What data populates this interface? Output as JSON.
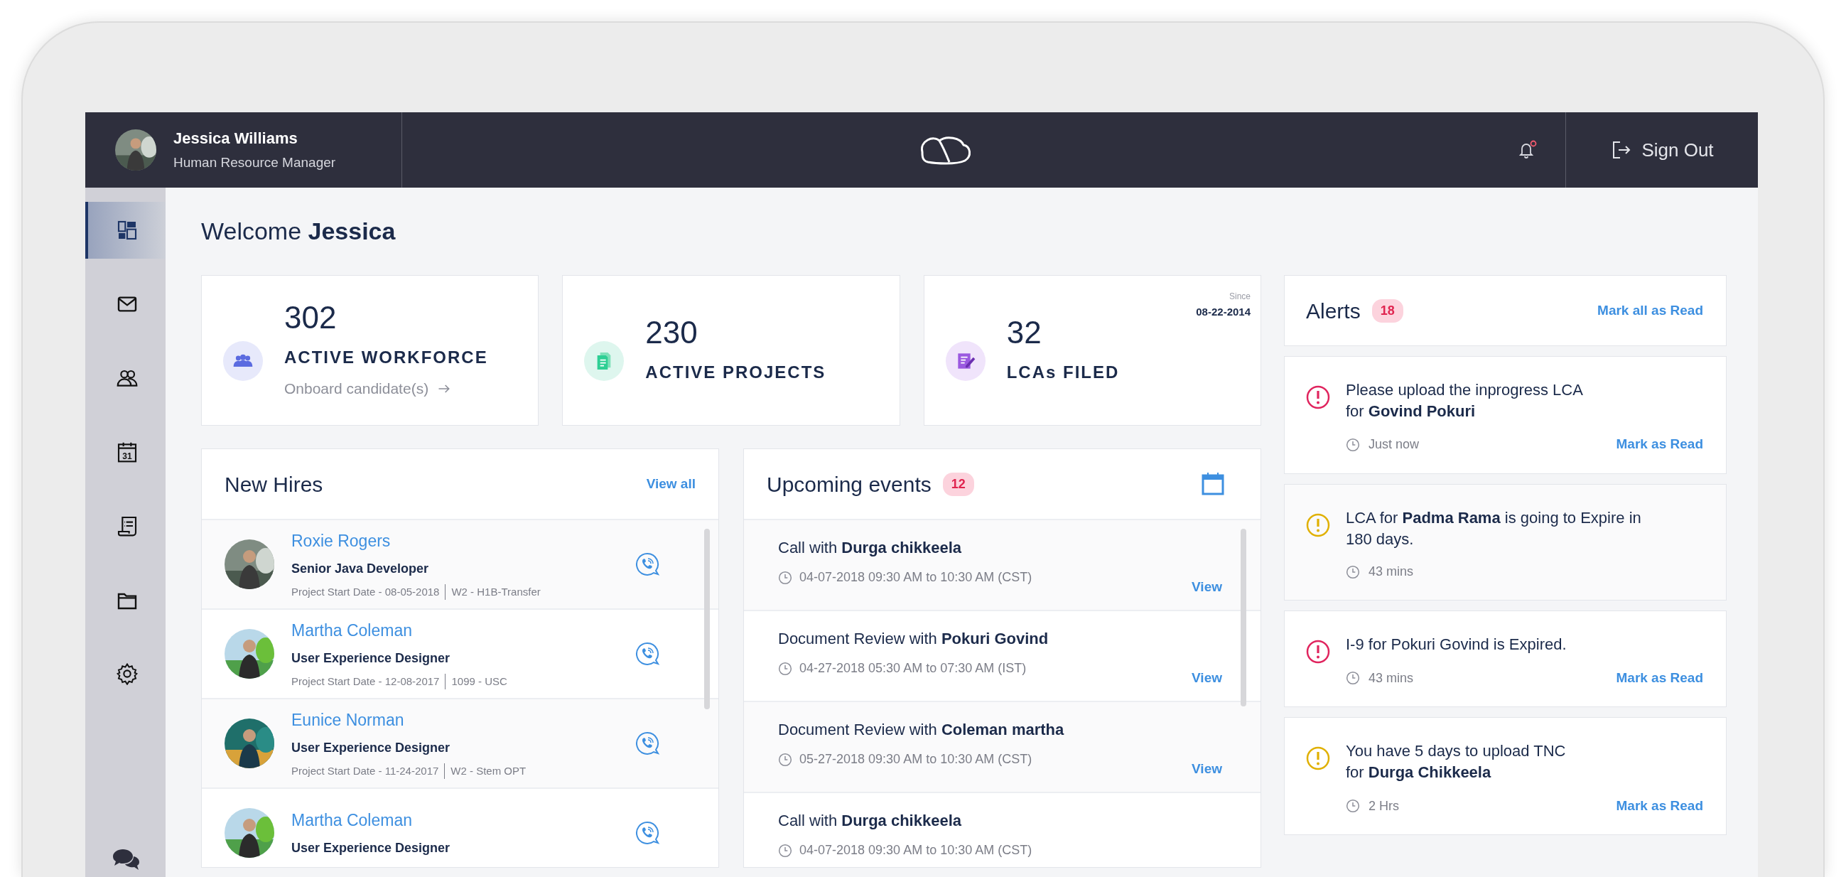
{
  "header": {
    "user_name": "Jessica Williams",
    "user_role": "Human Resource Manager",
    "notification_unread": true,
    "sign_out": "Sign Out"
  },
  "sidebar": {
    "items": [
      {
        "selected": true
      },
      {
        "selected": false
      },
      {
        "selected": false
      },
      {
        "icon_text": "31",
        "selected": false
      },
      {
        "selected": false
      },
      {
        "selected": false
      },
      {
        "selected": false
      }
    ]
  },
  "welcome": {
    "greeting": "Welcome",
    "name": "Jessica"
  },
  "stats": [
    {
      "kind": "workforce",
      "value": "302",
      "label": "ACTIVE WORKFORCE",
      "link": "Onboard candidate(s)"
    },
    {
      "kind": "projects",
      "value": "230",
      "label": "ACTIVE PROJECTS"
    },
    {
      "kind": "lcas",
      "value": "32",
      "label": "LCAs FILED",
      "since_label": "Since",
      "since_date": "08-22-2014"
    }
  ],
  "new_hires": {
    "title": "New Hires",
    "view_all": "View all",
    "items": [
      {
        "name": "Roxie Rogers",
        "role": "Senior Java Developer",
        "start_date": "Project Start Date - 08-05-2018",
        "visa": "W2 - H1B-Transfer"
      },
      {
        "name": "Martha Coleman",
        "role": "User Experience Designer",
        "start_date": "Project Start Date - 12-08-2017",
        "visa": "1099 - USC"
      },
      {
        "name": "Eunice Norman",
        "role": "User Experience Designer",
        "start_date": "Project Start Date - 11-24-2017",
        "visa": "W2 - Stem OPT"
      },
      {
        "name": "Martha Coleman",
        "role": "User Experience Designer"
      }
    ]
  },
  "events": {
    "title": "Upcoming events",
    "count": "12",
    "items": [
      {
        "title": "Call with **Durga chikkeela**",
        "time": "04-07-2018 09:30 AM to 10:30 AM (CST)",
        "view": "View"
      },
      {
        "title": "Document Review with **Pokuri Govind**",
        "time": "04-27-2018 05:30 AM to 07:30 AM (IST)",
        "view": "View"
      },
      {
        "title": "Document Review with **Coleman martha**",
        "time": "05-27-2018 09:30 AM to 10:30 AM (CST)",
        "view": "View"
      },
      {
        "title": "Call with **Durga chikkeela**",
        "time": "04-07-2018 09:30 AM to 10:30 AM (CST)"
      }
    ]
  },
  "alerts": {
    "title": "Alerts",
    "count": "18",
    "mark_all": "Mark all as Read",
    "items": [
      {
        "color": "#e0245e",
        "read": false,
        "text": "Please upload the inprogress LCA\nfor  **Govind Pokuri**",
        "time": "Just now",
        "action": "Mark as Read"
      },
      {
        "color": "#e0b000",
        "read": true,
        "text": "LCA for **Padma Rama** is going to Expire in\n180 days.",
        "time": "43 mins"
      },
      {
        "color": "#e0245e",
        "read": false,
        "text": "I-9 for Pokuri Govind is Expired.",
        "time": "43 mins",
        "action": "Mark as Read"
      },
      {
        "color": "#e0b000",
        "read": false,
        "text": "You have 5 days to upload TNC\nfor **Durga Chikkeela**",
        "time": "2 Hrs",
        "action": "Mark as Read"
      }
    ]
  }
}
